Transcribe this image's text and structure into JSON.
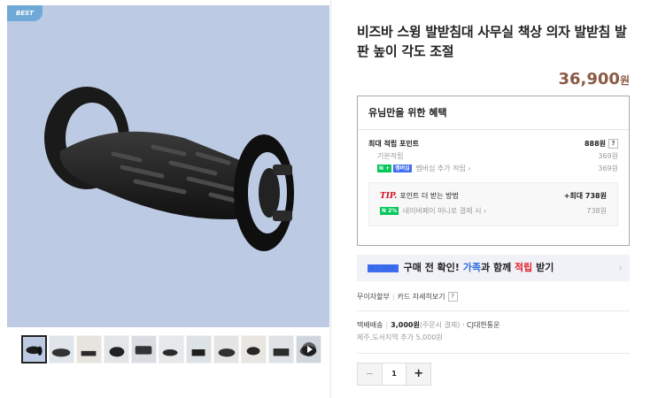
{
  "gallery": {
    "badge": "BEST",
    "thumb_count": 11,
    "selected_index": 0
  },
  "product": {
    "title": "비즈바 스윙 발받침대 사무실 책상 의자 발받침 발판 높이 각도 조절",
    "price": "36,900",
    "currency": "원"
  },
  "benefits": {
    "heading": "유님만을 위한 혜택",
    "max_points_label": "최대 적립 포인트",
    "max_points_value": "888원",
    "help": "?",
    "basic_label": "기본적립",
    "basic_value": "369원",
    "membership_label": "멤버십 추가 적립 ›",
    "membership_value": "369원",
    "npay_badge": "N +",
    "membership_badge": "멤버십",
    "tip_prefix": "TIP.",
    "tip_label": "포인트 더 받는 방법",
    "tip_value": "+최대 738원",
    "money_badge": "N 2%",
    "money_label": "네이버페이 머니로 결제 시 ›",
    "money_value": "738원"
  },
  "banner": {
    "badge": "N + 멤버십",
    "text_1": "구매 전 확인! ",
    "text_blue": "가족",
    "text_2": "과 함께 ",
    "text_red": "적립",
    "text_3": " 받기",
    "arrow": "›"
  },
  "installment": {
    "label": "무이자할부",
    "card_label": "카드 자세히보기",
    "help": "?"
  },
  "shipping": {
    "label": "택배배송",
    "fee": "3,000원",
    "fee_note": "(주문시 결제)",
    "carrier": "· CJ대한통운",
    "extra": "제주,도서지역 추가 5,000원"
  },
  "quantity": {
    "minus": "−",
    "value": "1",
    "plus": "+"
  },
  "colors": {
    "price": "#8a5a44",
    "image_bg": "#bccbe3",
    "badge_bg": "#6fa9d8",
    "npay_green": "#03c75a"
  }
}
